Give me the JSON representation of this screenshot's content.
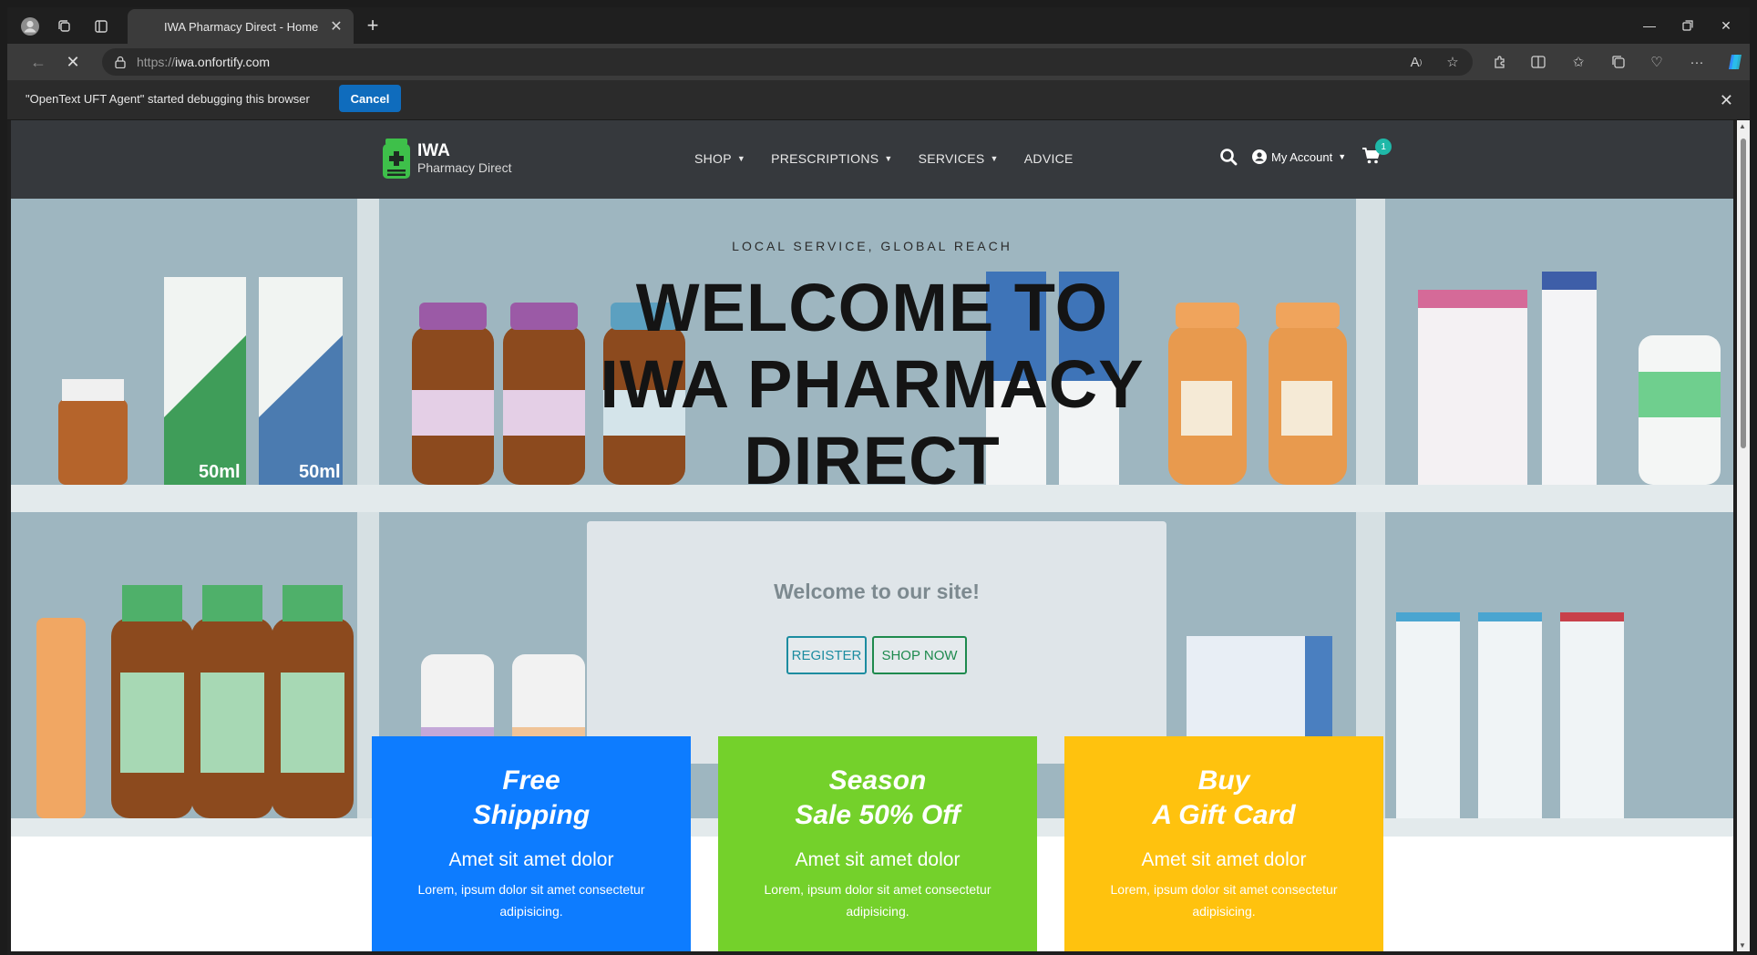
{
  "browser": {
    "tab_title": "IWA Pharmacy Direct - Home",
    "url_prefix": "https://",
    "url_host": "iwa.onfortify.com",
    "infobar_text": "\"OpenText UFT Agent\" started debugging this browser",
    "infobar_cancel": "Cancel"
  },
  "site": {
    "logo_name": "IWA",
    "logo_sub": "Pharmacy Direct",
    "nav": [
      {
        "label": "SHOP",
        "has_caret": true
      },
      {
        "label": "PRESCRIPTIONS",
        "has_caret": true
      },
      {
        "label": "SERVICES",
        "has_caret": true
      },
      {
        "label": "ADVICE",
        "has_caret": false
      }
    ],
    "caret_glyph": "▼",
    "account_label": "My Account",
    "cart_count": "1"
  },
  "hero": {
    "kicker": "LOCAL SERVICE, GLOBAL REACH",
    "title_lines": [
      "WELCOME TO",
      "IWA PHARMACY",
      "DIRECT"
    ],
    "welcome_title": "Welcome to our site!",
    "register_label": "REGISTER",
    "shop_now_label": "SHOP NOW"
  },
  "cards": [
    {
      "title_1": "Free",
      "title_2": "Shipping",
      "subtitle": "Amet sit amet dolor",
      "text": "Lorem, ipsum dolor sit amet consectetur adipisicing.",
      "color": "#0d7cff"
    },
    {
      "title_1": "Season",
      "title_2": "Sale 50% Off",
      "subtitle": "Amet sit amet dolor",
      "text": "Lorem, ipsum dolor sit amet consectetur adipisicing.",
      "color": "#74d12b"
    },
    {
      "title_1": "Buy",
      "title_2": "A Gift Card",
      "subtitle": "Amet sit amet dolor",
      "text": "Lorem, ipsum dolor sit amet consectetur adipisicing.",
      "color": "#ffc20e"
    }
  ],
  "colors": {
    "header_bg": "#36393d",
    "hero_bg": "#9eb6c0",
    "browser_accent": "#0f6cbd"
  }
}
